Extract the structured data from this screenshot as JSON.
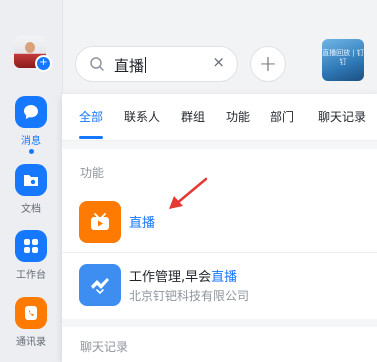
{
  "nav": {
    "items": [
      {
        "label": "消息"
      },
      {
        "label": "文档"
      },
      {
        "label": "工作台"
      },
      {
        "label": "通讯录"
      }
    ]
  },
  "search": {
    "query": "直播",
    "clear": "×"
  },
  "add_button": "+",
  "top_thumb_text": "直播回放 | 钉钉",
  "tabs": [
    "全部",
    "联系人",
    "群组",
    "功能",
    "部门",
    "聊天记录"
  ],
  "sections": {
    "functions": "功能",
    "chat_records": "聊天记录"
  },
  "results": [
    {
      "title_highlight": "直播"
    },
    {
      "title_prefix": "工作管理,早会",
      "title_highlight": "直播",
      "subtitle": "北京钉钯科技有限公司"
    }
  ],
  "colors": {
    "accent": "#1677ff",
    "live_icon_bg": "#ff7a00",
    "app_icon_bg": "#3d8ef0",
    "annotation_arrow": "#e53935"
  }
}
